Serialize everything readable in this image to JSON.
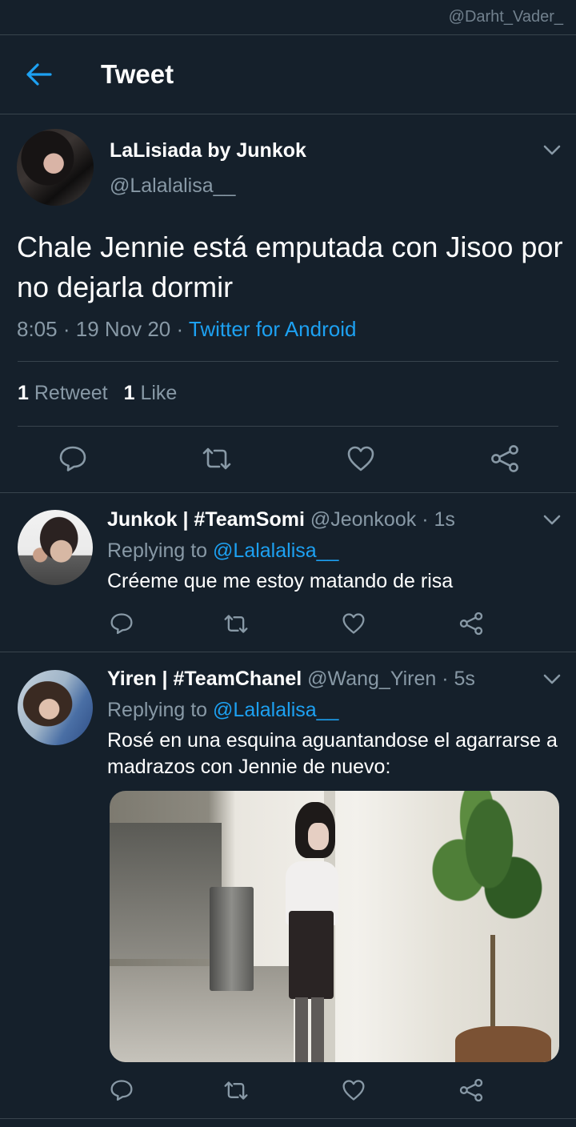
{
  "watermark": "@Darht_Vader_",
  "header": {
    "title": "Tweet"
  },
  "main_tweet": {
    "display_name": "LaLisiada by Junkok",
    "handle": "@Lalalalisa__",
    "text": "Chale Jennie está emputada con Jisoo por no dejarla dormir",
    "time": "8:05",
    "date": "19 Nov 20",
    "source": "Twitter for Android",
    "retweet_count": "1",
    "retweet_label": "Retweet",
    "like_count": "1",
    "like_label": "Like"
  },
  "replies": [
    {
      "display_name": "Junkok | #TeamSomi",
      "handle": "@Jeonkook",
      "age": "1s",
      "replying_prefix": "Replying to",
      "replying_to": "@Lalalalisa__",
      "text": "Créeme que me estoy matando de risa"
    },
    {
      "display_name": "Yiren | #TeamChanel",
      "handle": "@Wang_Yiren",
      "age": "5s",
      "replying_prefix": "Replying to",
      "replying_to": "@Lalalalisa__",
      "text": "Rosé en una esquina aguantandose el agarrarse a madrazos con Jennie de nuevo:"
    }
  ],
  "icons": {
    "back": "arrow-left-icon",
    "menu": "chevron-down-icon",
    "reply": "reply-bubble-icon",
    "retweet": "retweet-icon",
    "like": "heart-icon",
    "share": "share-icon"
  },
  "colors": {
    "background": "#15202b",
    "accent": "#1da1f2",
    "secondary_text": "#8899a6",
    "divider": "#38444d"
  }
}
